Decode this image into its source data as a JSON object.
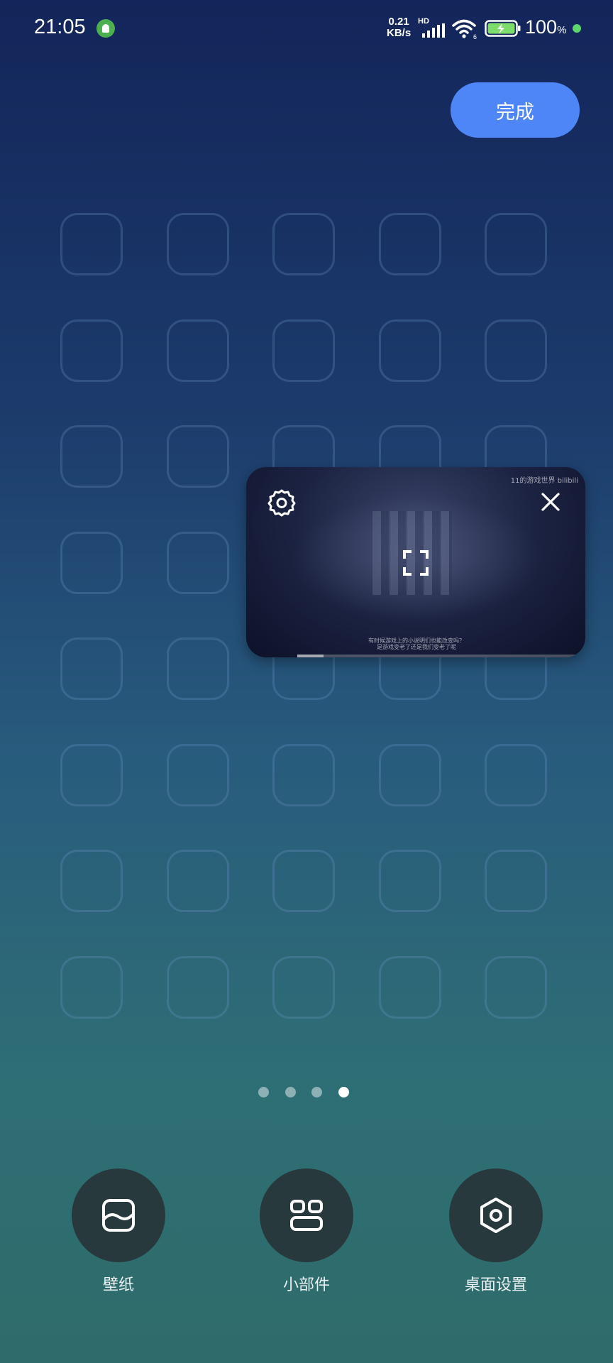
{
  "status_bar": {
    "time": "21:05",
    "net_speed_value": "0.21",
    "net_speed_unit": "KB/s",
    "hd_label": "HD",
    "wifi_badge": "6",
    "battery_percent": "100",
    "battery_unit": "%"
  },
  "header": {
    "done_label": "完成"
  },
  "pip": {
    "watermark": "11的游戏世界 bilibili",
    "subtitle_line1": "有时候游戏上的小说明们也能改变吗？",
    "subtitle_line2": "是游戏变老了还是我们变老了呢",
    "progress": 0.09
  },
  "pager": {
    "total_pages": 4,
    "active_index": 3
  },
  "bottom_actions": [
    {
      "label": "壁纸",
      "icon": "wallpaper-icon"
    },
    {
      "label": "小部件",
      "icon": "widgets-icon"
    },
    {
      "label": "桌面设置",
      "icon": "desktop-settings-icon"
    }
  ],
  "colors": {
    "accent": "#4f86f7",
    "action_circle": "#27393c",
    "status_green": "#5dd66d"
  }
}
